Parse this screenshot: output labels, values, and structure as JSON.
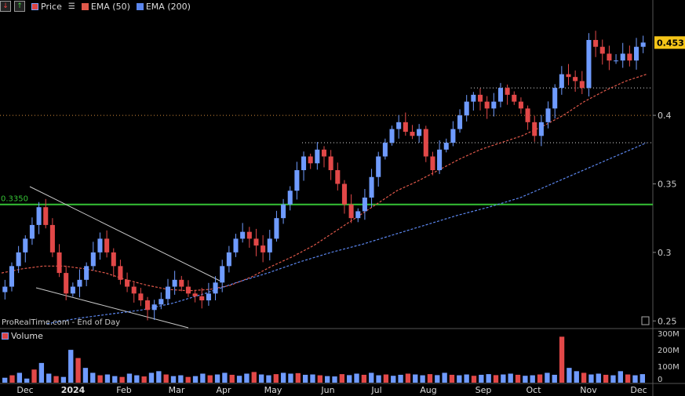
{
  "toolbar": {
    "price_label": "Price",
    "ema50_label": "EMA (50)",
    "ema200_label": "EMA (200)"
  },
  "credit": "ProRealTime.com - End of Day",
  "volume_label": "Volume",
  "colors": {
    "background": "#000000",
    "up_candle": "#6f9bff",
    "down_candle": "#e24848",
    "ema50": "#e0584a",
    "ema200": "#5b86ee",
    "support_line": "#35c235",
    "trendline": "#c8c8c8",
    "last_price_badge": "#f5c518",
    "resistance_dots": "#d9d9d9",
    "orange_dots": "#d08a3a"
  },
  "chart_data": [
    {
      "type": "candlestick",
      "title": "",
      "x": [
        "Dec",
        "2024",
        "Feb",
        "Mar",
        "Apr",
        "May",
        "Jun",
        "Jul",
        "Aug",
        "Sep",
        "Oct",
        "Nov",
        "Dec"
      ],
      "y_ticks": [
        "0.25",
        "0.3",
        "0.35",
        "0.4"
      ],
      "ylim": [
        0.245,
        0.475
      ],
      "last_price": "0.4531",
      "support_level": {
        "label": "0.3350",
        "value": 0.335
      },
      "resistance_levels": [
        0.42,
        0.4,
        0.38
      ],
      "price_path": [
        0.275,
        0.29,
        0.3,
        0.31,
        0.32,
        0.333,
        0.32,
        0.3,
        0.285,
        0.27,
        0.275,
        0.28,
        0.29,
        0.3,
        0.31,
        0.3,
        0.29,
        0.28,
        0.275,
        0.27,
        0.265,
        0.258,
        0.262,
        0.266,
        0.275,
        0.28,
        0.275,
        0.27,
        0.268,
        0.265,
        0.27,
        0.278,
        0.29,
        0.3,
        0.31,
        0.315,
        0.31,
        0.305,
        0.3,
        0.31,
        0.325,
        0.335,
        0.345,
        0.36,
        0.37,
        0.365,
        0.375,
        0.37,
        0.36,
        0.35,
        0.335,
        0.325,
        0.33,
        0.34,
        0.355,
        0.37,
        0.38,
        0.39,
        0.395,
        0.388,
        0.385,
        0.39,
        0.37,
        0.36,
        0.375,
        0.38,
        0.39,
        0.4,
        0.41,
        0.415,
        0.41,
        0.405,
        0.41,
        0.42,
        0.415,
        0.41,
        0.405,
        0.395,
        0.385,
        0.395,
        0.405,
        0.42,
        0.43,
        0.428,
        0.425,
        0.42,
        0.455,
        0.45,
        0.445,
        0.44,
        0.44,
        0.445,
        0.44,
        0.45,
        0.4531
      ],
      "ema50": [
        0.285,
        0.288,
        0.29,
        0.29,
        0.288,
        0.285,
        0.28,
        0.276,
        0.273,
        0.272,
        0.273,
        0.276,
        0.282,
        0.29,
        0.297,
        0.305,
        0.315,
        0.325,
        0.335,
        0.345,
        0.352,
        0.36,
        0.368,
        0.375,
        0.38,
        0.385,
        0.392,
        0.4,
        0.41,
        0.418,
        0.425,
        0.43
      ],
      "ema200": [
        0.248,
        0.252,
        0.255,
        0.258,
        0.263,
        0.27,
        0.278,
        0.285,
        0.293,
        0.3,
        0.306,
        0.313,
        0.32,
        0.327,
        0.333,
        0.34,
        0.35,
        0.36,
        0.37,
        0.38
      ],
      "grid": false
    },
    {
      "type": "bar",
      "title": "Volume",
      "y_ticks": [
        "0",
        "100M",
        "200M",
        "300M"
      ],
      "ylim": [
        0,
        320000000
      ],
      "values_millions": [
        30,
        45,
        60,
        25,
        80,
        120,
        55,
        40,
        35,
        200,
        150,
        90,
        60,
        45,
        50,
        40,
        35,
        55,
        45,
        38,
        60,
        70,
        50,
        40,
        45,
        35,
        40,
        55,
        45,
        50,
        60,
        48,
        42,
        55,
        65,
        50,
        45,
        52,
        60,
        55,
        58,
        48,
        50,
        45,
        40,
        38,
        52,
        46,
        55,
        48,
        60,
        45,
        50,
        42,
        48,
        55,
        50,
        45,
        52,
        46,
        60,
        48,
        45,
        50,
        42,
        48,
        52,
        46,
        50,
        55,
        48,
        42,
        45,
        50,
        60,
        48,
        280,
        90,
        70,
        60,
        50,
        55,
        48,
        45,
        70,
        50,
        45,
        52
      ]
    }
  ]
}
